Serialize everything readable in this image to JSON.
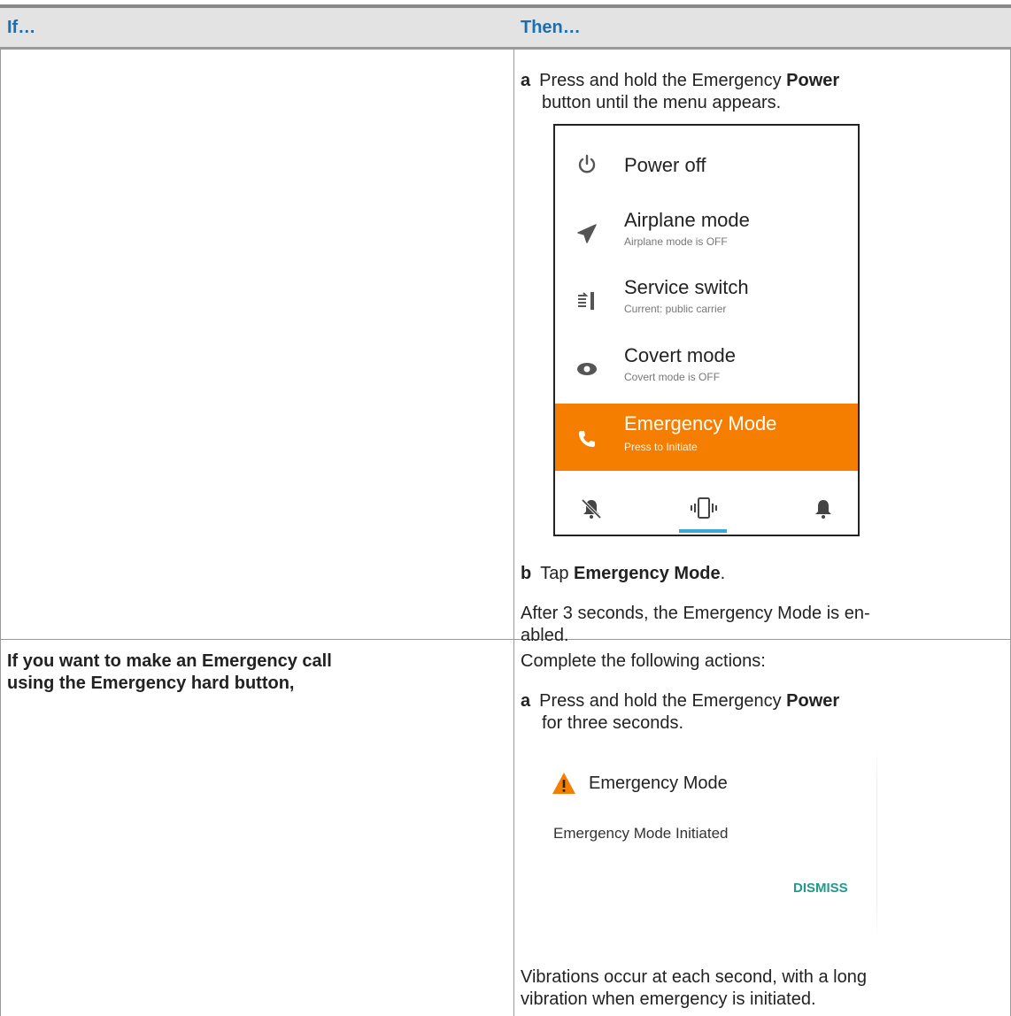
{
  "table": {
    "header": {
      "col_if": "If…",
      "col_then": "Then…"
    },
    "row1": {
      "step_a_letter": "a",
      "step_a_pre": "Press and hold the Emergency ",
      "step_a_bold": "Power",
      "step_a_line2": "button until the menu appears.",
      "step_b_letter": "b",
      "step_b_pre": "Tap ",
      "step_b_bold": "Emergency Mode",
      "step_b_post": ".",
      "note_line1": "After 3 seconds, the Emergency Mode is en-",
      "note_line2": "abled."
    },
    "row2": {
      "if_line1": "If you want to make an Emergency call",
      "if_line2": "using the Emergency hard button,",
      "intro": "Complete the following actions:",
      "step_a_letter": "a",
      "step_a_pre": "Press and hold the Emergency ",
      "step_a_bold": "Power",
      "step_a_line2": "for three seconds.",
      "note_line1": "Vibrations occur at each second, with a long",
      "note_line2": "vibration when emergency is initiated."
    }
  },
  "power_menu": {
    "items": [
      {
        "title": "Power off",
        "subtitle": "",
        "icon": "power-icon"
      },
      {
        "title": "Airplane mode",
        "subtitle": "Airplane mode is OFF",
        "icon": "airplane-icon"
      },
      {
        "title": "Service switch",
        "subtitle": "Current: public carrier",
        "icon": "service-switch-icon"
      },
      {
        "title": "Covert mode",
        "subtitle": "Covert mode is OFF",
        "icon": "eye-icon"
      },
      {
        "title": "Emergency Mode",
        "subtitle": "Press to Initiate",
        "icon": "phone-icon"
      }
    ],
    "bottom_icons": [
      "bell-off-icon",
      "vibrate-icon",
      "bell-icon"
    ],
    "selected_sound_mode": "vibrate",
    "colors": {
      "emergency": "#f57e00",
      "selected_underline": "#39a9d6"
    }
  },
  "emergency_dialog": {
    "title": "Emergency Mode",
    "message": "Emergency Mode Initiated",
    "dismiss": "DISMISS",
    "icon": "warning-icon",
    "colors": {
      "warning": "#f57e00",
      "dismiss": "#1f9a8c"
    }
  },
  "colors": {
    "header_text": "#1a6fb3",
    "header_bg": "#e3e3e3"
  }
}
